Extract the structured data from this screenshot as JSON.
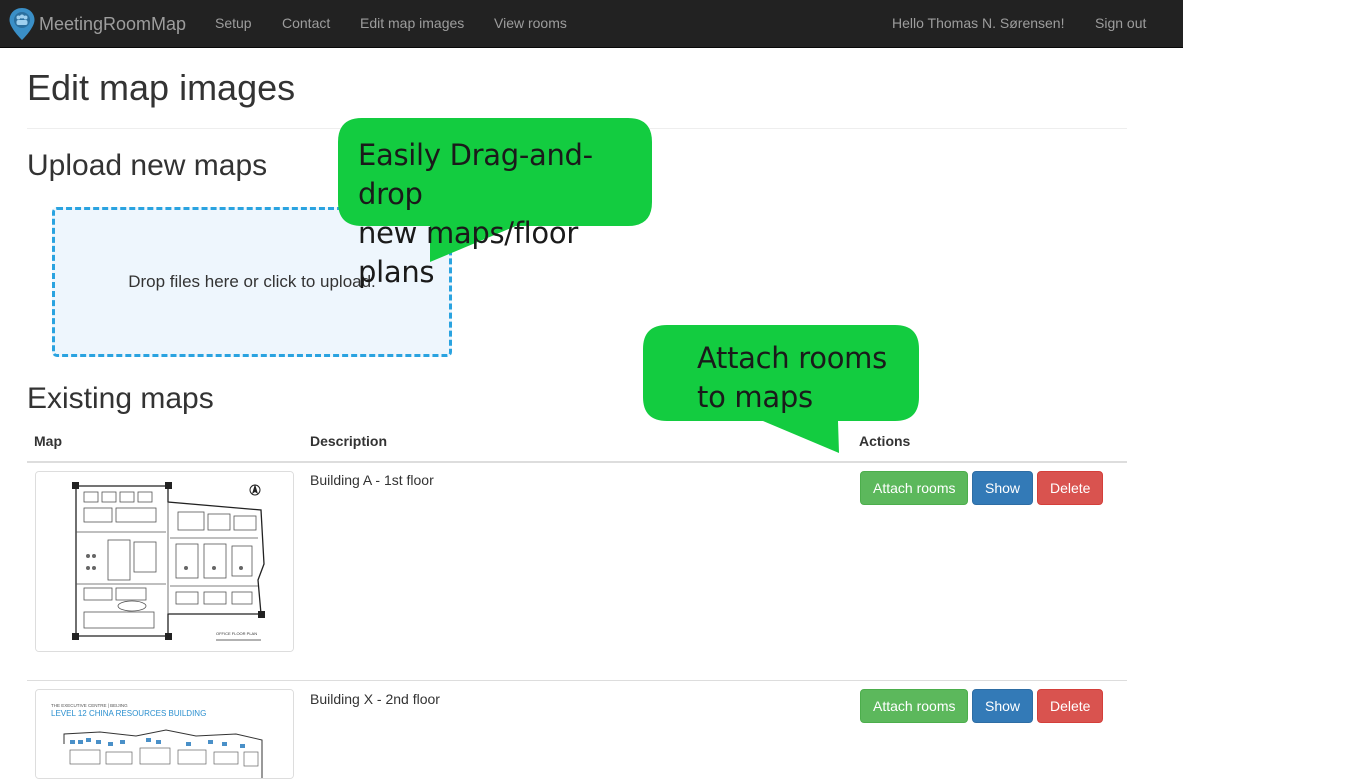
{
  "navbar": {
    "brand": "MeetingRoomMap",
    "links": [
      "Setup",
      "Contact",
      "Edit map images",
      "View rooms"
    ],
    "greeting": "Hello Thomas N. Sørensen!",
    "signout": "Sign out"
  },
  "page": {
    "title": "Edit map images",
    "upload_heading": "Upload new maps",
    "dropzone_text": "Drop files here or click to upload.",
    "existing_heading": "Existing maps"
  },
  "table": {
    "headers": [
      "Map",
      "Description",
      "Actions"
    ],
    "rows": [
      {
        "description": "Building A - 1st floor",
        "thumb_caption": "OFFICE FLOOR PLAN"
      },
      {
        "description": "Building X - 2nd floor",
        "thumb_line1": "THE EXECUTIVE CENTRE  |  BEIJING",
        "thumb_line2": "LEVEL 12 CHINA RESOURCES BUILDING"
      }
    ],
    "actions": {
      "attach": "Attach rooms",
      "show": "Show",
      "delete": "Delete"
    }
  },
  "callouts": {
    "drag_drop": [
      "Easily Drag-and-drop",
      "new maps/floor plans"
    ],
    "attach": [
      "Attach rooms",
      "to maps"
    ]
  },
  "colors": {
    "navbar_bg": "#222222",
    "callout_green": "#13cc40",
    "dropzone_border": "#2aa3e0",
    "success": "#5cb85c",
    "primary": "#337ab7",
    "danger": "#d9534f"
  }
}
